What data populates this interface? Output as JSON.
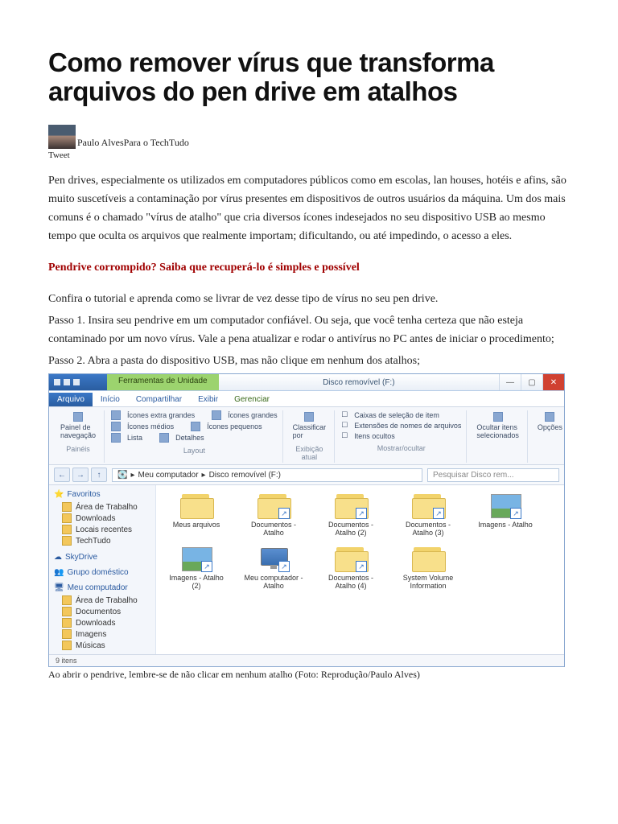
{
  "title": "Como remover vírus que transforma arquivos do pen drive em atalhos",
  "author_name": "Paulo Alves",
  "author_source": "Para o TechTudo",
  "tweet_label": "Tweet",
  "paragraph1": "Pen drives, especialmente os utilizados em computadores públicos como em escolas, lan houses, hotéis e afins, são muito suscetíveis a contaminação por vírus presentes em dispositivos de outros usuários da máquina. Um dos mais comuns é o chamado \"vírus de atalho\" que cria diversos ícones indesejados no seu dispositivo USB ao mesmo tempo que oculta os arquivos que realmente importam; dificultando, ou até impedindo, o acesso a eles.",
  "red_link": "Pendrive corrompido? Saiba que recuperá-lo é simples e possível",
  "paragraph2": "Confira o tutorial e aprenda como se livrar de vez desse tipo de vírus no seu pen drive.",
  "step1": "Passo 1. Insira seu pendrive em um computador confiável. Ou seja, que você tenha certeza que não esteja contaminado por um novo vírus. Vale a pena atualizar e rodar o antivírus no PC antes de iniciar o procedimento;",
  "step2": "Passo 2. Abra a pasta do dispositivo USB, mas não clique em nenhum dos atalhos;",
  "caption": "Ao abrir o pendrive, lembre-se de não clicar em nenhum atalho (Foto: Reprodução/Paulo Alves)",
  "win": {
    "context_tab": "Ferramentas de Unidade",
    "window_title": "Disco removível (F:)",
    "tabs": {
      "file": "Arquivo",
      "home": "Início",
      "share": "Compartilhar",
      "view": "Exibir",
      "manage": "Gerenciar"
    },
    "ribbon": {
      "panel_nav": "Painel de navegação",
      "panels": "Painéis",
      "icons_xl": "Ícones extra grandes",
      "icons_l": "Ícones grandes",
      "icons_m": "Ícones médios",
      "icons_s": "Ícones pequenos",
      "list": "Lista",
      "details": "Detalhes",
      "layout": "Layout",
      "sort": "Classificar por",
      "current_view": "Exibição atual",
      "cb_item_check": "Caixas de seleção de item",
      "cb_ext": "Extensões de nomes de arquivos",
      "cb_hidden": "Itens ocultos",
      "hide_selected": "Ocultar itens selecionados",
      "show_hide": "Mostrar/ocultar",
      "options": "Opções"
    },
    "path": {
      "root": "Meu computador",
      "drive": "Disco removível (F:)"
    },
    "search_placeholder": "Pesquisar Disco rem...",
    "sidebar": {
      "favorites": "Favoritos",
      "desktop": "Área de Trabalho",
      "downloads": "Downloads",
      "recent": "Locais recentes",
      "techtudo": "TechTudo",
      "skydrive": "SkyDrive",
      "homegroup": "Grupo doméstico",
      "computer": "Meu computador",
      "c_desktop": "Área de Trabalho",
      "c_docs": "Documentos",
      "c_downloads": "Downloads",
      "c_images": "Imagens",
      "c_music": "Músicas"
    },
    "files": {
      "f1": "Meus arquivos",
      "f2": "Documentos - Atalho",
      "f3": "Documentos - Atalho (2)",
      "f4": "Documentos - Atalho (3)",
      "f5": "Imagens - Atalho",
      "f6": "Imagens - Atalho (2)",
      "f7": "Meu computador - Atalho",
      "f8": "Documentos - Atalho (4)",
      "f9": "System Volume Information"
    },
    "status": "9 itens"
  }
}
